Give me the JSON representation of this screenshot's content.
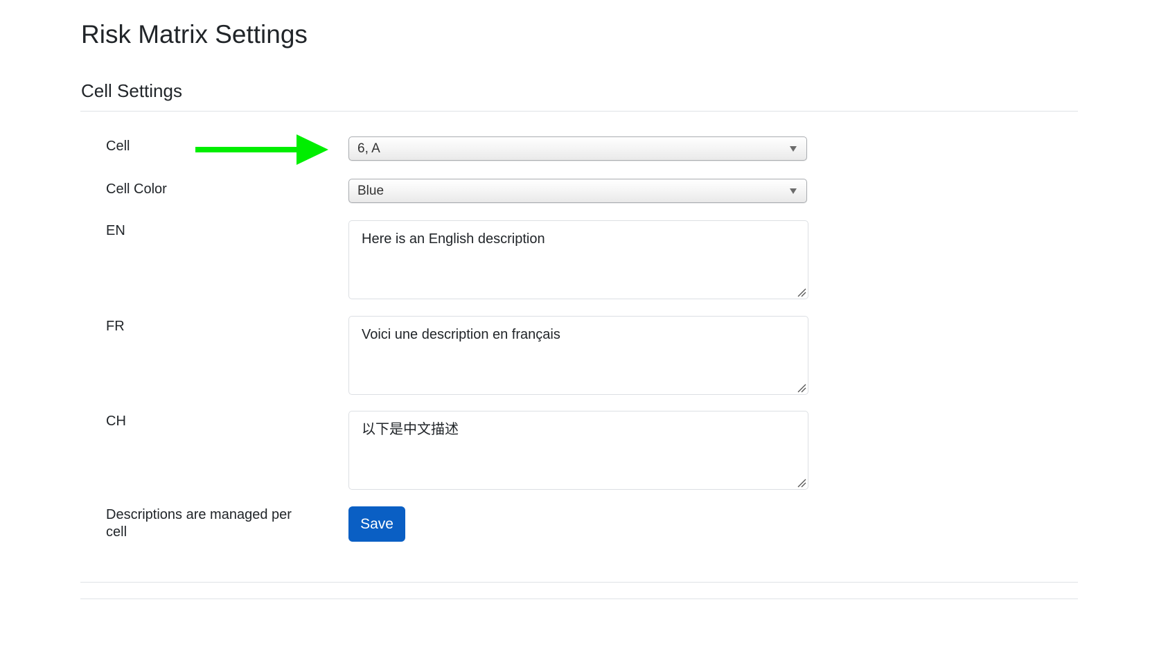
{
  "page": {
    "title": "Risk Matrix Settings",
    "section_title": "Cell Settings"
  },
  "form": {
    "cell": {
      "label": "Cell",
      "value": "6, A"
    },
    "cell_color": {
      "label": "Cell Color",
      "value": "Blue"
    },
    "en": {
      "label": "EN",
      "value": "Here is an English description"
    },
    "fr": {
      "label": "FR",
      "value": "Voici une description en français"
    },
    "ch": {
      "label": "CH",
      "value": "以下是中文描述"
    },
    "note": "Descriptions are managed per cell",
    "save_label": "Save"
  },
  "annotation": {
    "arrow_color": "#00ee00",
    "arrow_icon": "right-arrow-icon"
  },
  "colors": {
    "primary_button": "#0a5fc4",
    "text": "#212529",
    "rule": "#dee2e6"
  }
}
